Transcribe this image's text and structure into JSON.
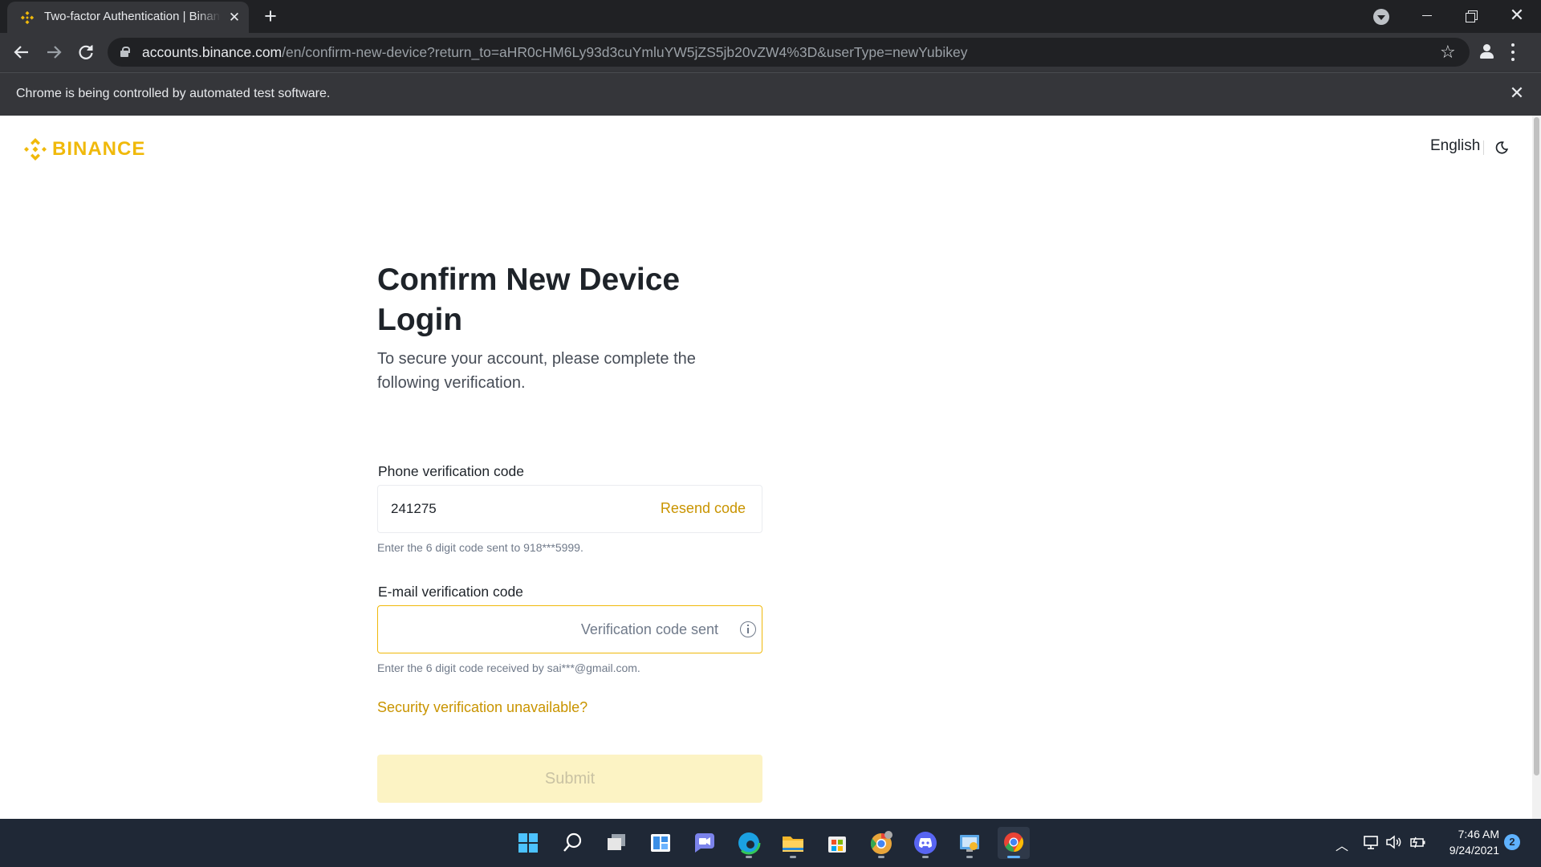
{
  "browser": {
    "tab_title": "Two-factor Authentication | Binance",
    "tab_close": "✕",
    "new_tab": "+",
    "url_host": "accounts.binance.com",
    "url_path": "/en/confirm-new-device?return_to=aHR0cHM6Ly93d3cuYmluYW5jZS5jb20vZW4%3D&userType=newYubikey",
    "infobar_text": "Chrome is being controlled by automated test software.",
    "infobar_close": "✕",
    "window_close": "✕"
  },
  "header": {
    "logo_text": "BINANCE",
    "language": "English"
  },
  "form": {
    "title": "Confirm New Device Login",
    "subtitle": "To secure your account, please complete the following verification.",
    "phone": {
      "label": "Phone verification code",
      "value": "241275",
      "resend_label": "Resend code",
      "help": "Enter the 6 digit code sent to 918***5999."
    },
    "email": {
      "label": "E-mail verification code",
      "value": "",
      "status": "Verification code sent",
      "help": "Enter the 6 digit code received by sai***@gmail.com."
    },
    "security_link": "Security verification unavailable?",
    "submit_label": "Submit"
  },
  "taskbar": {
    "apps": [
      "start-icon",
      "search-icon",
      "task-view-icon",
      "widgets-icon",
      "teams-chat-icon",
      "edge-icon",
      "file-explorer-icon",
      "store-icon",
      "chrome-canary-icon",
      "discord-icon",
      "control-panel-icon",
      "chrome-icon"
    ],
    "time": "7:46 AM",
    "date": "9/24/2021",
    "notification_count": "2"
  },
  "colors": {
    "brand": "#f0b90b",
    "link": "#c99400",
    "submit_bg": "#fcf3c4",
    "taskbar": "#1f2836"
  }
}
